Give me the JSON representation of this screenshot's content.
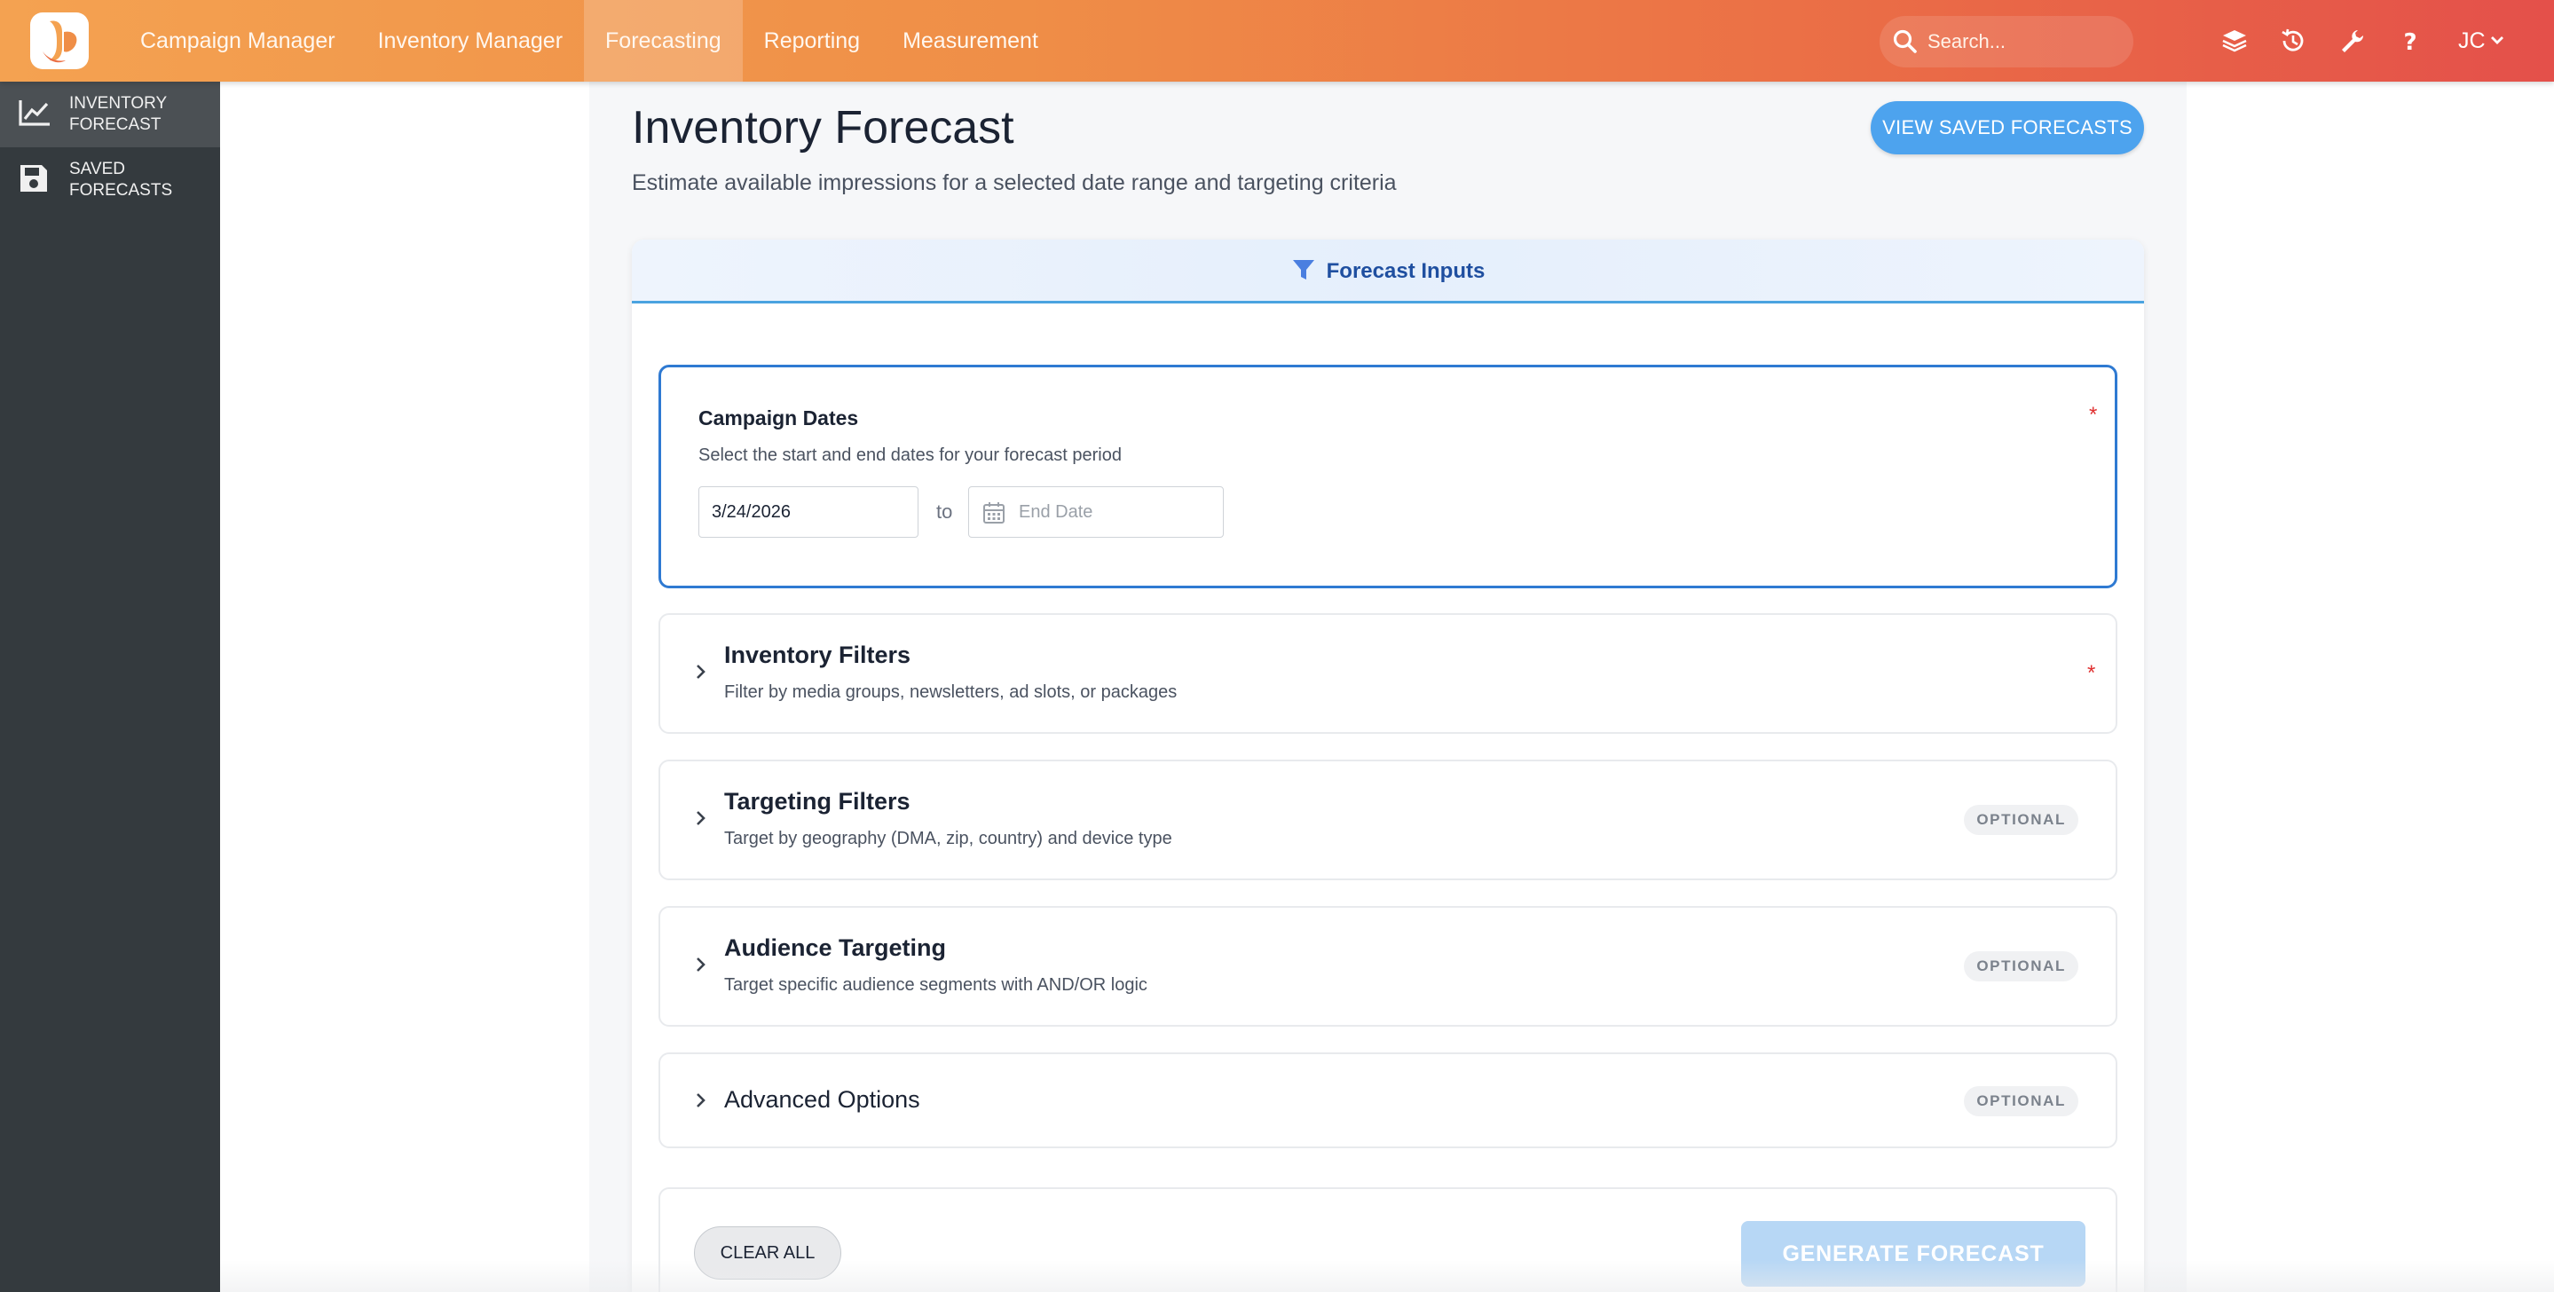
{
  "topnav": {
    "logo": "brand-logo",
    "items": [
      {
        "label": "Campaign Manager",
        "active": false
      },
      {
        "label": "Inventory Manager",
        "active": false
      },
      {
        "label": "Forecasting",
        "active": true
      },
      {
        "label": "Reporting",
        "active": false
      },
      {
        "label": "Measurement",
        "active": false
      }
    ],
    "search_placeholder": "Search...",
    "icons": [
      "layers-icon",
      "history-icon",
      "wrench-icon",
      "help-icon"
    ],
    "user_initials": "JC"
  },
  "sidebar": {
    "items": [
      {
        "label": "INVENTORY FORECAST",
        "icon": "chart-line-icon",
        "active": true
      },
      {
        "label": "SAVED FORECASTS",
        "icon": "save-icon",
        "active": false
      }
    ]
  },
  "page": {
    "title": "Inventory Forecast",
    "subtitle": "Estimate available impressions for a selected date range and targeting criteria",
    "view_saved_label": "VIEW SAVED FORECASTS"
  },
  "card": {
    "header_title": "Forecast Inputs",
    "campaign_dates": {
      "label": "Campaign Dates",
      "description": "Select the start and end dates for your forecast period",
      "required_mark": "*",
      "start_value": "3/24/2026",
      "to_label": "to",
      "end_placeholder": "End Date"
    },
    "sections": [
      {
        "title": "Inventory Filters",
        "description": "Filter by media groups, newsletters, ad slots, or packages",
        "marker": "*"
      },
      {
        "title": "Targeting Filters",
        "description": "Target by geography (DMA, zip, country) and device type",
        "marker": "OPTIONAL"
      },
      {
        "title": "Audience Targeting",
        "description": "Target specific audience segments with AND/OR logic",
        "marker": "OPTIONAL"
      },
      {
        "title": "Advanced Options",
        "description": "",
        "marker": "OPTIONAL"
      }
    ],
    "clear_label": "CLEAR ALL",
    "generate_label": "GENERATE FORECAST"
  },
  "colors": {
    "accent_blue": "#4da3ee",
    "focus_border": "#2f7ad2",
    "required_red": "#e03030",
    "nav_gradient_start": "#f4a251",
    "nav_gradient_end": "#e4504a",
    "sidebar_bg": "#343a3e"
  }
}
